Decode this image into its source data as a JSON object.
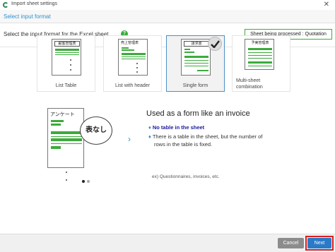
{
  "window": {
    "title": "Import sheet settings",
    "close_glyph": "✕"
  },
  "header": {
    "title": "Select input format"
  },
  "instruction": {
    "text": "Select the input format for the Excel sheet.",
    "help_glyph": "?"
  },
  "status": {
    "text": "Sheet being processed : Quotation"
  },
  "formats": [
    {
      "label": "List Table",
      "sheet_title": "顧客管理表",
      "selected": false
    },
    {
      "label": "List with header",
      "sheet_title": "売上管理表",
      "selected": false
    },
    {
      "label": "Single form",
      "sheet_title": "請求書",
      "selected": true
    },
    {
      "label_line1": "Multi-sheet",
      "label_line2": "combination",
      "sheet_title": "予実管理表",
      "selected": false
    }
  ],
  "illustration": {
    "sheet_title": "アンケート",
    "bubble_text": "表なし",
    "chevron_glyph": "›",
    "pager_active": 0,
    "pager_count": 2
  },
  "description": {
    "title": "Used as a form like an invoice",
    "bullet_glyph": "♦",
    "bullet1": "No table in the sheet",
    "bullet2_line1": "There is a table in the sheet, but the number of",
    "bullet2_line2": "rows in the table is fixed.",
    "example": "ex) Questionnaires, invoices, etc."
  },
  "footer": {
    "cancel_label": "Cancel",
    "next_label": "Next"
  },
  "colors": {
    "accent_blue": "#2f8fce",
    "green": "#3cab3c",
    "next_highlight": "#d92020"
  }
}
